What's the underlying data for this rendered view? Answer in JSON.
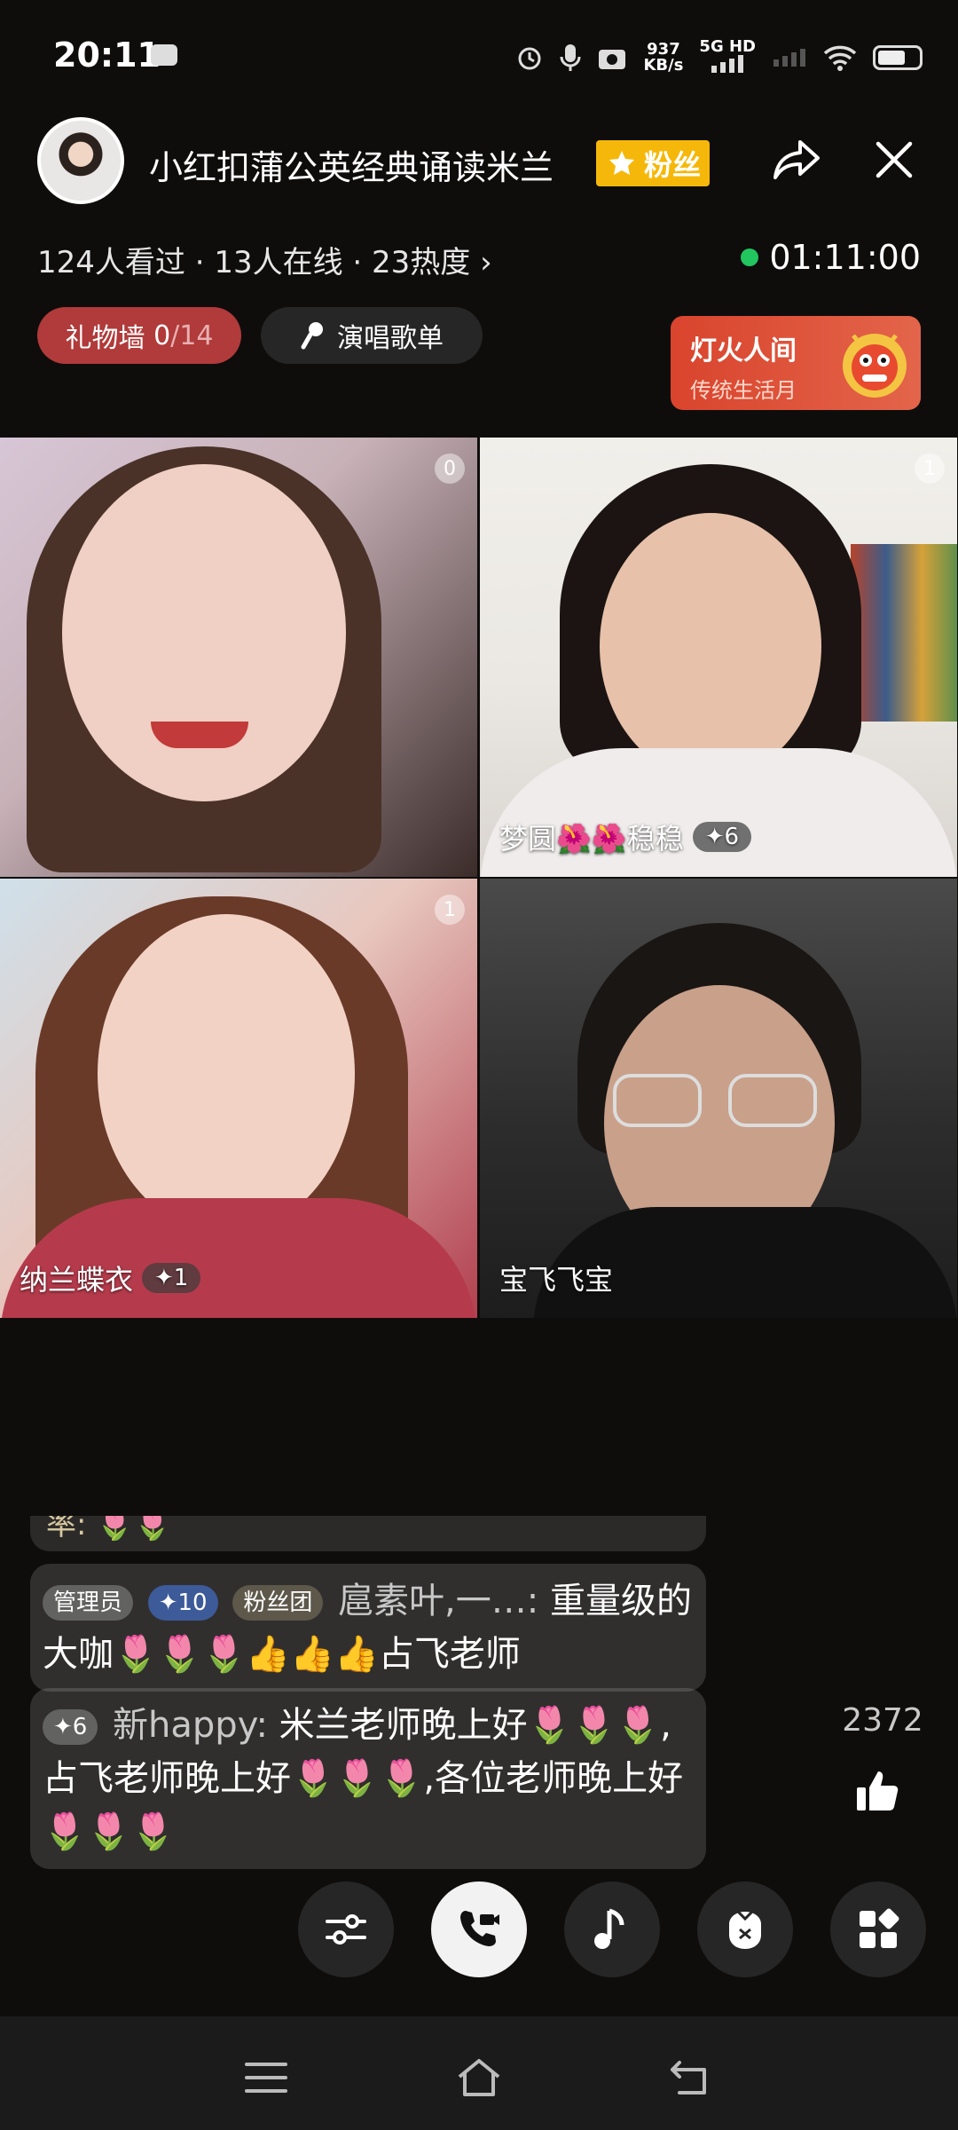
{
  "status_bar": {
    "time": "20:11",
    "net_speed_value": "937",
    "net_speed_unit": "KB/s",
    "net_type": "5G HD"
  },
  "header": {
    "host_name": "小红扣蒲公英经典诵读米兰",
    "fan_badge": "粉丝",
    "stats": "124人看过 · 13人在线 · 23热度 ›",
    "live_duration": "01:11:00",
    "gift_wall_label": "礼物墙",
    "gift_wall_count": "0",
    "gift_wall_total": "/14",
    "song_list_label": "演唱歌单",
    "promo_title": "灯火人间",
    "promo_subtitle": "传统生活月",
    "accent": "#f5b80a"
  },
  "tiles": [
    {
      "seat": "0",
      "name": "",
      "level": ""
    },
    {
      "seat": "1",
      "name": "梦圆🌺🌺稳稳",
      "level": "✦6"
    },
    {
      "seat": "1",
      "name": "纳兰蝶衣",
      "level": "✦1"
    },
    {
      "seat": "",
      "name": "宝飞飞宝",
      "level": ""
    }
  ],
  "chat": {
    "partial_prev": "率: 🌷🌷",
    "messages": [
      {
        "badges": [
          "管理员",
          "✦10",
          "粉丝团"
        ],
        "user": "扈素叶,一…:",
        "text": "重量级的大咖🌷🌷🌷👍👍👍占飞老师"
      },
      {
        "badges": [
          "✦6"
        ],
        "user": "新happy:",
        "text": "米兰老师晚上好🌷🌷🌷,占飞老师晚上好🌷🌷🌷,各位老师晚上好🌷🌷🌷"
      }
    ]
  },
  "likes": {
    "count": "2372"
  },
  "toolbar": [
    "sliders-icon",
    "video-call-icon",
    "music-note-icon",
    "gift-bag-icon",
    "apps-icon"
  ],
  "navbar": [
    "menu-icon",
    "home-icon",
    "back-icon"
  ]
}
